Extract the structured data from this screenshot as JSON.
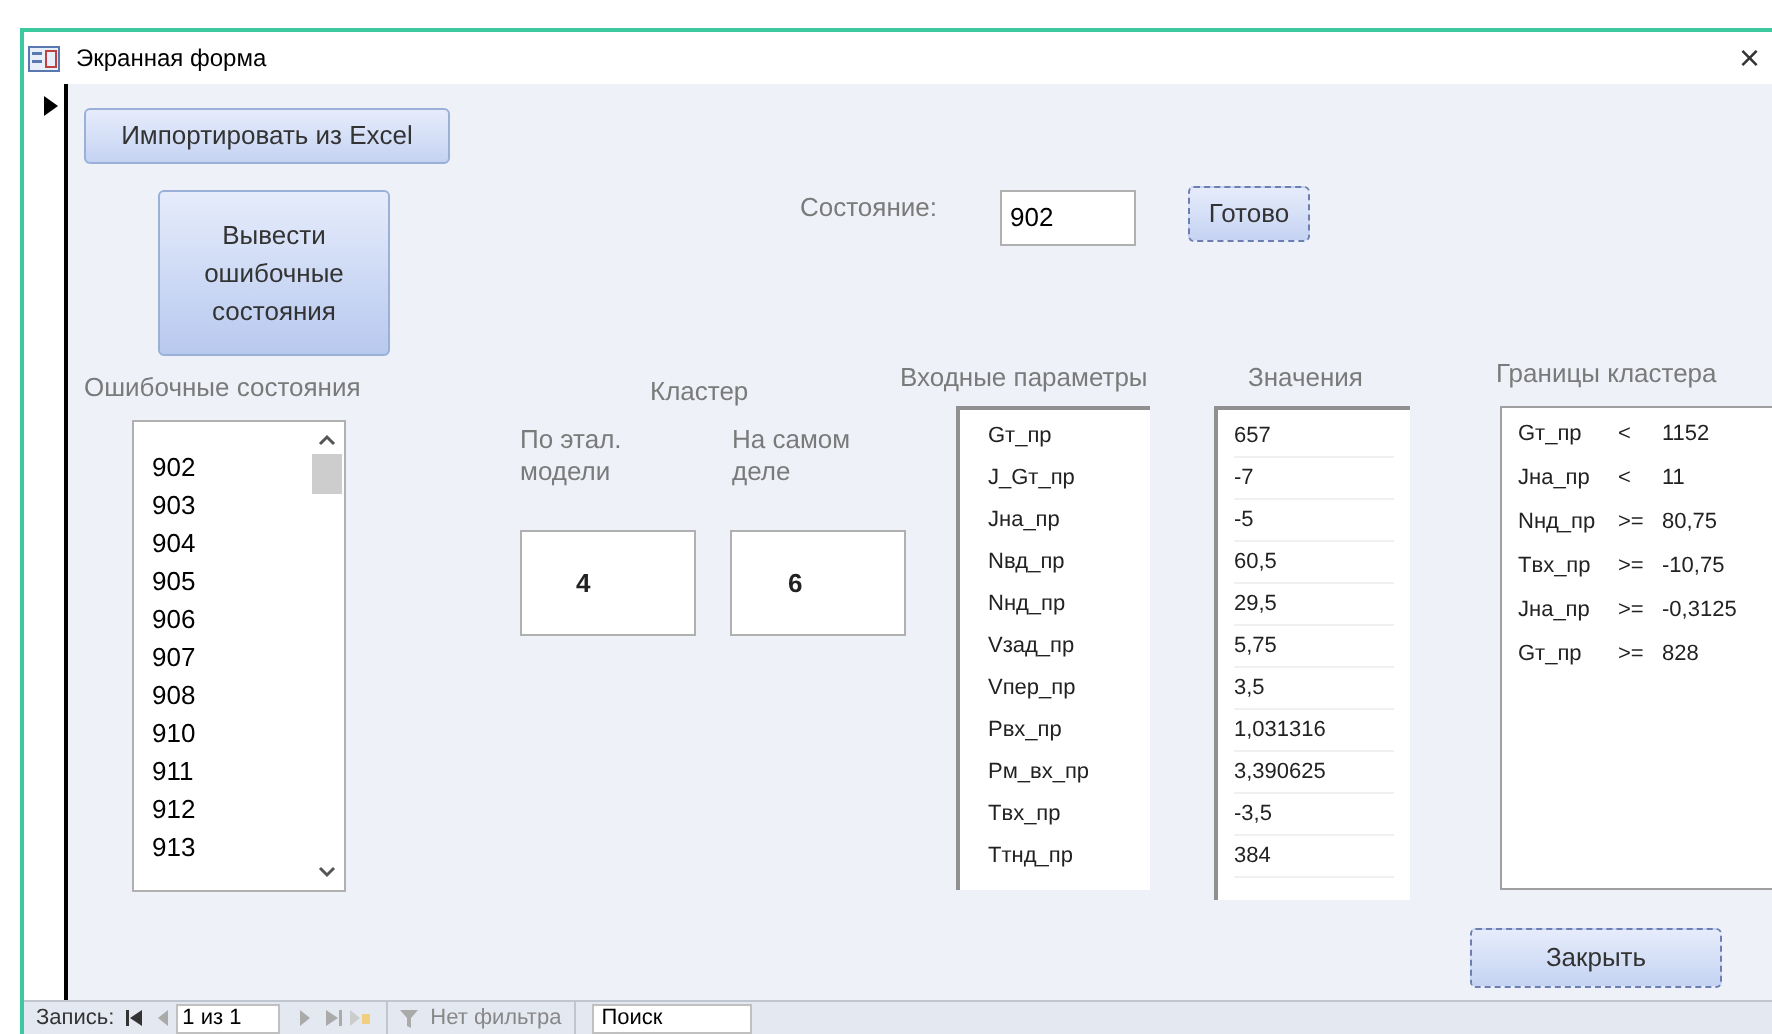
{
  "window": {
    "title": "Экранная форма",
    "close": "×"
  },
  "import_button": "Импортировать из Excel",
  "show_errors_button": "Вывести ошибочные состояния",
  "error_states": {
    "label": "Ошибочные состояния",
    "items": [
      "902",
      "903",
      "904",
      "905",
      "906",
      "907",
      "908",
      "910",
      "911",
      "912",
      "913"
    ]
  },
  "cluster": {
    "label": "Кластер",
    "reference_label": "По этал. модели",
    "actual_label": "На самом деле",
    "reference_value": "4",
    "actual_value": "6"
  },
  "state": {
    "label": "Состояние:",
    "value": "902",
    "button": "Готово"
  },
  "inputs": {
    "label": "Входные параметры",
    "items": [
      "Gт_пр",
      "J_Gт_пр",
      "Jна_пр",
      "Nвд_пр",
      "Nнд_пр",
      "Vзад_пр",
      "Vпер_пр",
      "Pвх_пр",
      "Pм_вх_пр",
      "Tвх_пр",
      "Tтнд_пр"
    ]
  },
  "values": {
    "label": "Значения",
    "items": [
      "657",
      "-7",
      "-5",
      "60,5",
      "29,5",
      "5,75",
      "3,5",
      "1,031316",
      "3,390625",
      "-3,5",
      "384"
    ]
  },
  "bounds": {
    "label": "Границы кластера",
    "rows": [
      {
        "name": "Gт_пр",
        "op": "<",
        "value": "1152"
      },
      {
        "name": "Jна_пр",
        "op": "<",
        "value": "11"
      },
      {
        "name": "Nнд_пр",
        "op": ">=",
        "value": "80,75"
      },
      {
        "name": "Tвх_пр",
        "op": ">=",
        "value": "-10,75"
      },
      {
        "name": "Jна_пр",
        "op": ">=",
        "value": "-0,3125"
      },
      {
        "name": "Gт_пр",
        "op": ">=",
        "value": "828"
      }
    ]
  },
  "close_button": "Закрыть",
  "status_bar": {
    "record_label": "Запись:",
    "position": "1 из 1",
    "filter": "Нет фильтра",
    "search": "Поиск"
  }
}
